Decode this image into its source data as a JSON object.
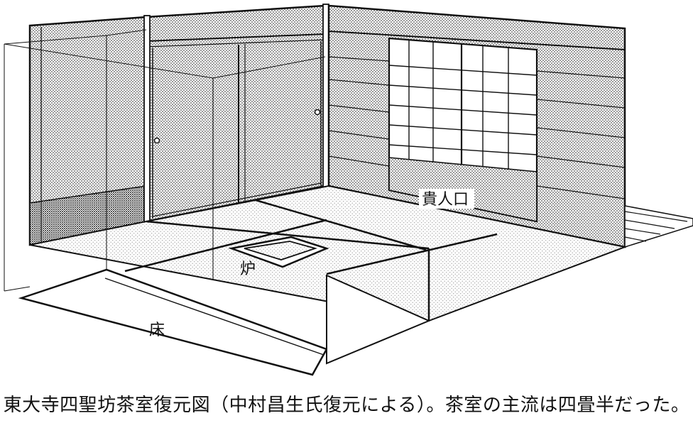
{
  "labels": {
    "kijinguchi": "貴人口",
    "ro": "炉",
    "toko": "床"
  },
  "caption": "東大寺四聖坊茶室復元図（中村昌生氏復元による）。茶室の主流は四畳半だった。",
  "colors": {
    "line": "#111111",
    "wall_screen": "#9a9a9a",
    "floor_screen": "#cfcfcf",
    "background": "#ffffff"
  }
}
